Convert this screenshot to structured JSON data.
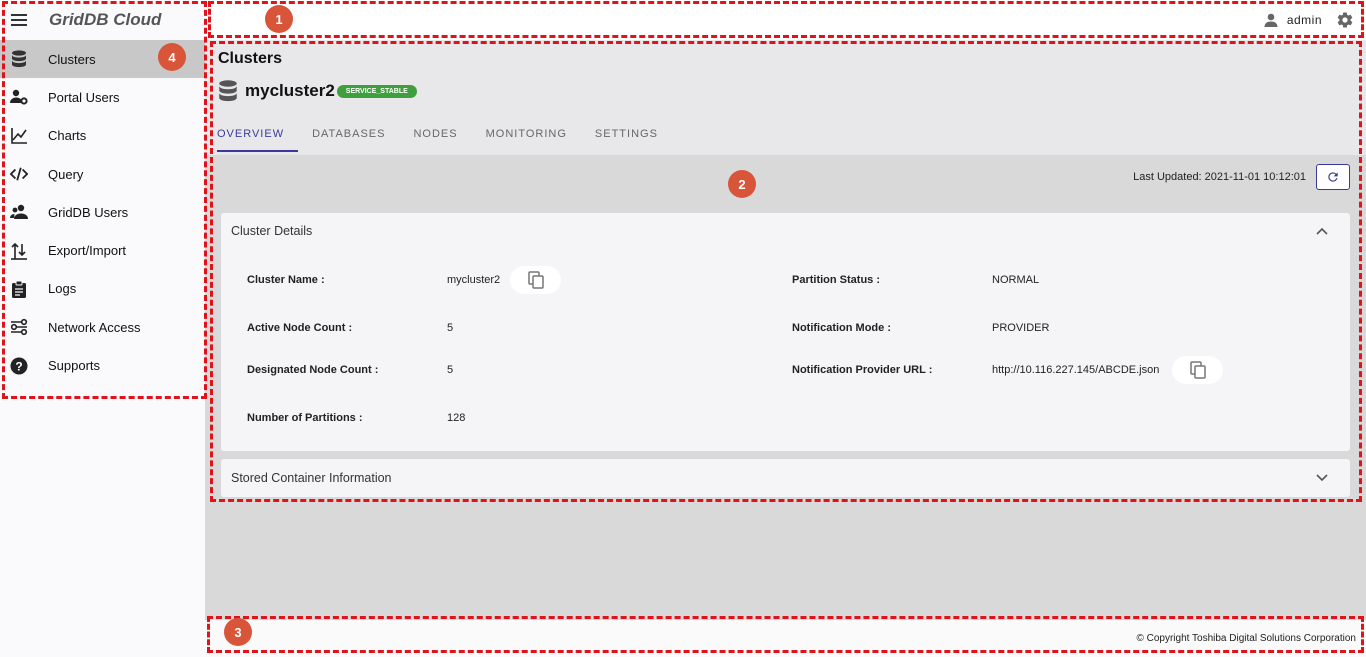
{
  "app": {
    "brand": "GridDB Cloud"
  },
  "topbar": {
    "user": "admin"
  },
  "sidebar": {
    "items": [
      {
        "label": "Clusters",
        "icon": "database-icon",
        "active": true
      },
      {
        "label": "Portal Users",
        "icon": "user-cog-icon"
      },
      {
        "label": "Charts",
        "icon": "line-chart-icon"
      },
      {
        "label": "Query",
        "icon": "code-icon"
      },
      {
        "label": "GridDB Users",
        "icon": "users-icon"
      },
      {
        "label": "Export/Import",
        "icon": "export-import-icon"
      },
      {
        "label": "Logs",
        "icon": "clipboard-icon"
      },
      {
        "label": "Network Access",
        "icon": "network-icon"
      },
      {
        "label": "Supports",
        "icon": "help-icon"
      }
    ]
  },
  "page": {
    "title": "Clusters",
    "cluster_name": "mycluster2",
    "status_badge": "SERVICE_STABLE",
    "tabs": [
      "OVERVIEW",
      "DATABASES",
      "NODES",
      "MONITORING",
      "SETTINGS"
    ],
    "active_tab": "OVERVIEW",
    "last_updated": "Last Updated: 2021-11-01 10:12:01"
  },
  "details": {
    "title": "Cluster Details",
    "fields": {
      "cluster_name": {
        "label": "Cluster Name :",
        "value": "mycluster2"
      },
      "active_nodes": {
        "label": "Active Node Count :",
        "value": "5"
      },
      "designated_nodes": {
        "label": "Designated Node Count :",
        "value": "5"
      },
      "partitions": {
        "label": "Number of Partitions :",
        "value": "128"
      },
      "partition_status": {
        "label": "Partition Status :",
        "value": "NORMAL"
      },
      "notification_mode": {
        "label": "Notification Mode :",
        "value": "PROVIDER"
      },
      "provider_url": {
        "label": "Notification Provider URL :",
        "value": "http://10.116.227.145/ABCDE.json"
      }
    }
  },
  "stored": {
    "title": "Stored Container Information"
  },
  "footer": {
    "copyright": "© Copyright Toshiba Digital Solutions Corporation"
  },
  "annotations": [
    "1",
    "2",
    "3",
    "4"
  ],
  "colors": {
    "accent": "#3a3a9a",
    "badge": "#3f9f3f",
    "annotation": "#e0121a",
    "marker": "#d9553a"
  }
}
